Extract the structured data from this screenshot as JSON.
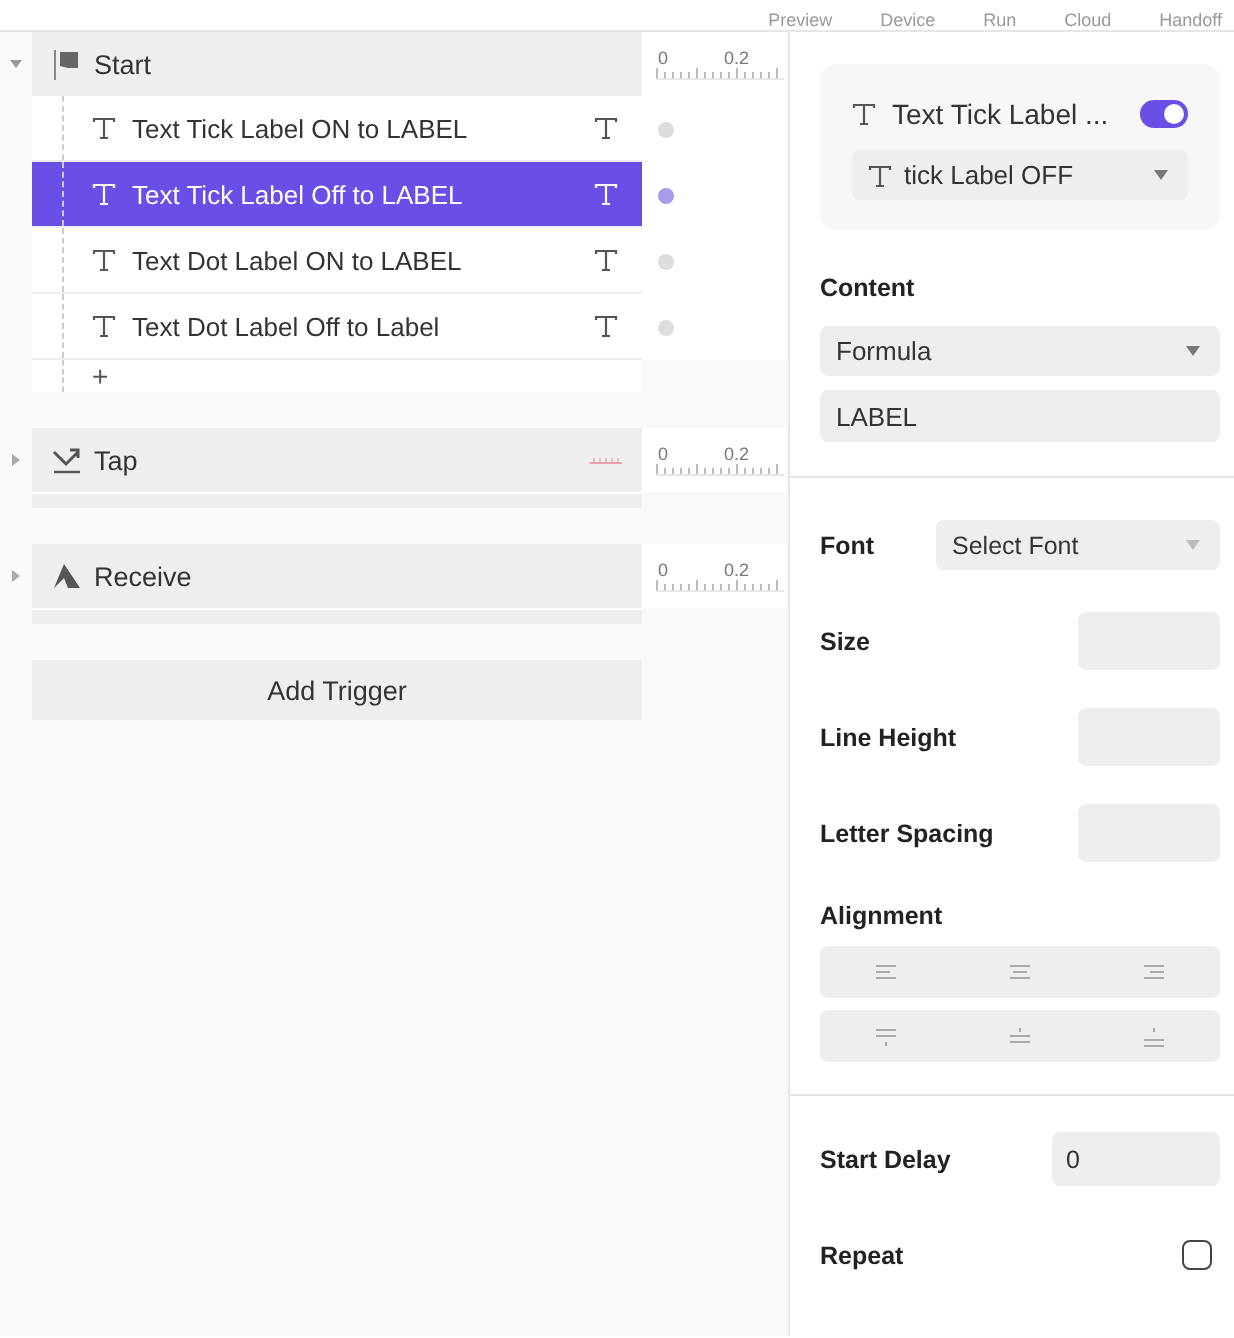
{
  "toolbar": [
    "Preview",
    "Device",
    "Run",
    "Cloud",
    "Handoff"
  ],
  "triggers": [
    {
      "kind": "start",
      "label": "Start",
      "expanded": true,
      "ruler": [
        "0",
        "0.2"
      ],
      "items": [
        {
          "label": "Text Tick Label ON to LABEL",
          "selected": false
        },
        {
          "label": "Text Tick Label Off to LABEL",
          "selected": true
        },
        {
          "label": "Text Dot Label ON to LABEL",
          "selected": false
        },
        {
          "label": "Text Dot Label Off to Label",
          "selected": false
        }
      ],
      "add": "+"
    },
    {
      "kind": "tap",
      "label": "Tap",
      "expanded": false,
      "ruler": [
        "0",
        "0.2"
      ]
    },
    {
      "kind": "receive",
      "label": "Receive",
      "expanded": false,
      "ruler": [
        "0",
        "0.2"
      ]
    }
  ],
  "add_trigger": "Add Trigger",
  "inspector": {
    "layer": {
      "title": "Text Tick Label ...",
      "on": true,
      "state": "tick Label OFF"
    },
    "content": {
      "heading": "Content",
      "type": "Formula",
      "value": "LABEL"
    },
    "props": [
      {
        "kind": "select",
        "label": "Font",
        "placeholder": "Select Font"
      },
      {
        "kind": "input",
        "label": "Size"
      },
      {
        "kind": "input",
        "label": "Line Height"
      },
      {
        "kind": "input",
        "label": "Letter Spacing"
      }
    ],
    "alignment": {
      "label": "Alignment"
    },
    "start_delay": {
      "label": "Start Delay",
      "value": "0"
    },
    "repeat": {
      "label": "Repeat",
      "checked": false
    }
  }
}
